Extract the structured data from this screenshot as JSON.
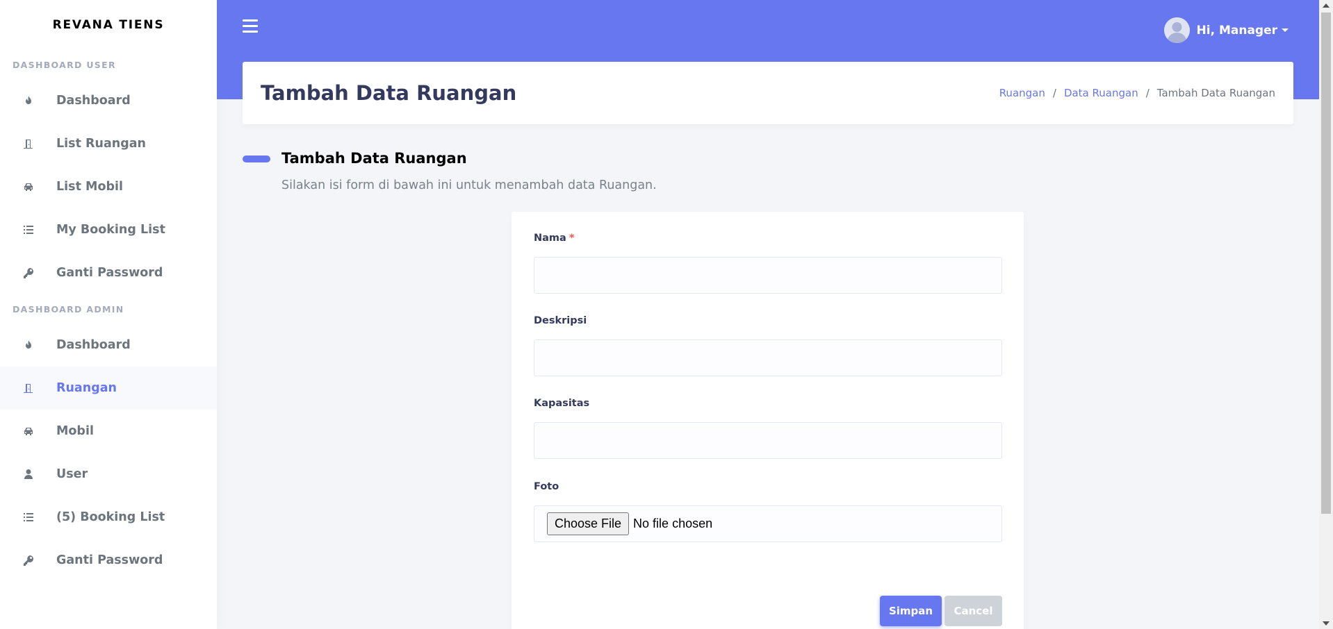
{
  "brand": "REVANA TIENS",
  "sidebar": {
    "user_header": "DASHBOARD USER",
    "user_items": [
      {
        "label": "Dashboard",
        "icon": "fire-icon"
      },
      {
        "label": "List Ruangan",
        "icon": "door-icon"
      },
      {
        "label": "List Mobil",
        "icon": "car-icon"
      },
      {
        "label": "My Booking List",
        "icon": "list-icon"
      },
      {
        "label": "Ganti Password",
        "icon": "key-icon"
      }
    ],
    "admin_header": "DASHBOARD ADMIN",
    "admin_items": [
      {
        "label": "Dashboard",
        "icon": "fire-icon"
      },
      {
        "label": "Ruangan",
        "icon": "door-icon",
        "active": true
      },
      {
        "label": "Mobil",
        "icon": "car-icon"
      },
      {
        "label": "User",
        "icon": "user-icon"
      },
      {
        "label": "(5) Booking List",
        "icon": "list-icon"
      },
      {
        "label": "Ganti Password",
        "icon": "key-icon"
      }
    ]
  },
  "navbar": {
    "user_greeting": "Hi, Manager"
  },
  "header": {
    "title": "Tambah Data Ruangan",
    "breadcrumb": [
      "Ruangan",
      "Data Ruangan",
      "Tambah Data Ruangan"
    ],
    "separator": "/"
  },
  "section": {
    "title": "Tambah Data Ruangan",
    "lead": "Silakan isi form di bawah ini untuk menambah data Ruangan."
  },
  "form": {
    "nama_label": "Nama",
    "required_mark": "*",
    "nama_value": "",
    "deskripsi_label": "Deskripsi",
    "deskripsi_value": "",
    "kapasitas_label": "Kapasitas",
    "kapasitas_value": "",
    "foto_label": "Foto",
    "choose_file_label": "Choose File",
    "file_status": "No file chosen",
    "submit_label": "Simpan",
    "cancel_label": "Cancel"
  },
  "colors": {
    "primary": "#6777ef",
    "sidebar_active_bg": "#f8f9fc",
    "page_bg": "#f4f5f9",
    "required": "#fc544b",
    "cancel": "#cdd3d8"
  }
}
